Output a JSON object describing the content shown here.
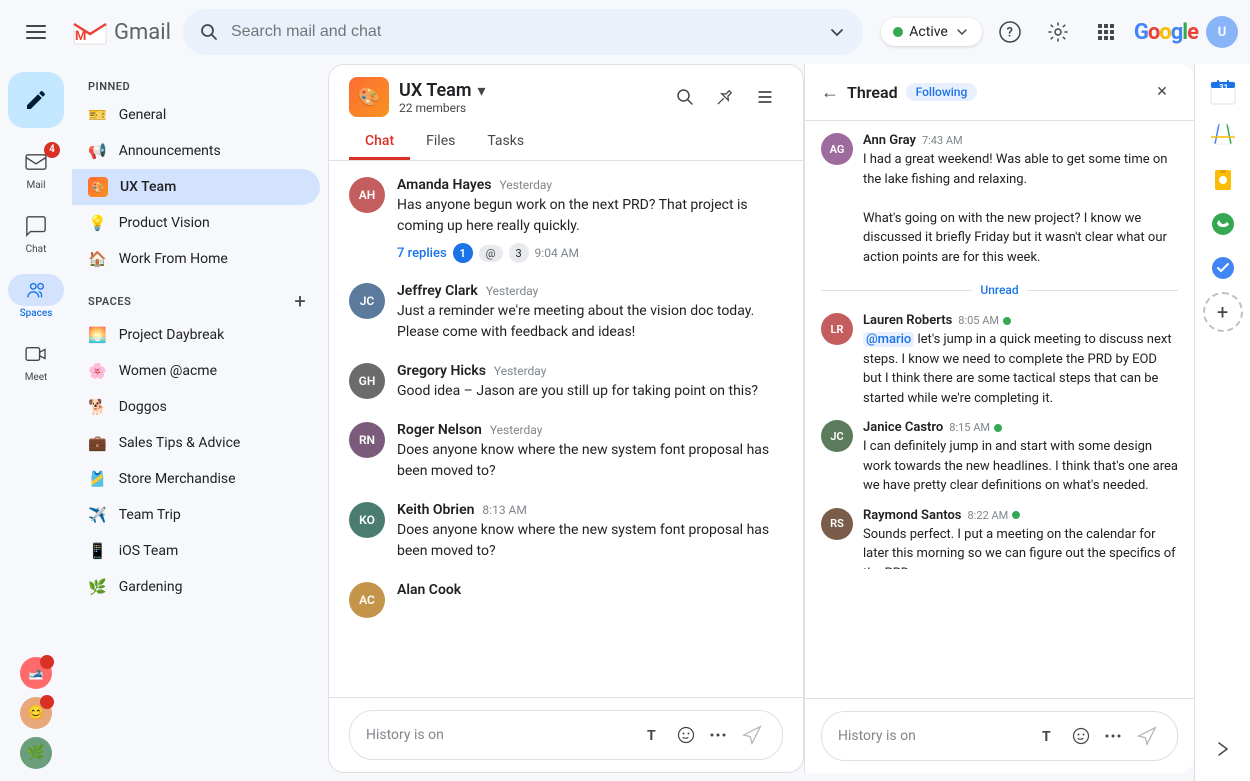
{
  "topbar": {
    "search_placeholder": "Search mail and chat",
    "active_label": "Active",
    "active_dropdown": "▾"
  },
  "left_nav": {
    "compose_icon": "✏",
    "nav_items": [
      {
        "id": "mail",
        "label": "Mail",
        "icon": "✉",
        "badge": "4"
      },
      {
        "id": "chat",
        "label": "Chat",
        "icon": "💬",
        "badge": null
      },
      {
        "id": "spaces",
        "label": "Spaces",
        "icon": "👥",
        "active": true
      },
      {
        "id": "meet",
        "label": "Meet",
        "icon": "📹",
        "badge": null
      }
    ]
  },
  "sidebar": {
    "pinned_label": "PINNED",
    "spaces_label": "SPACES",
    "pinned_items": [
      {
        "id": "general",
        "label": "General",
        "icon": "🎫"
      },
      {
        "id": "announcements",
        "label": "Announcements",
        "icon": "📢"
      },
      {
        "id": "ux-team",
        "label": "UX Team",
        "icon": "🎨",
        "active": true
      },
      {
        "id": "product-vision",
        "label": "Product Vision",
        "icon": "💡"
      },
      {
        "id": "work-from-home",
        "label": "Work From Home",
        "icon": "🏠"
      }
    ],
    "spaces_items": [
      {
        "id": "project-daybreak",
        "label": "Project Daybreak",
        "icon": "🌅"
      },
      {
        "id": "women-acme",
        "label": "Women @acme",
        "icon": "🌸"
      },
      {
        "id": "doggos",
        "label": "Doggos",
        "icon": "🐕"
      },
      {
        "id": "sales-tips",
        "label": "Sales Tips & Advice",
        "icon": "💼"
      },
      {
        "id": "store-merchandise",
        "label": "Store Merchandise",
        "icon": "🎽"
      },
      {
        "id": "team-trip",
        "label": "Team Trip",
        "icon": "✈"
      },
      {
        "id": "ios-team",
        "label": "iOS Team",
        "icon": "📱"
      },
      {
        "id": "gardening",
        "label": "Gardening",
        "icon": "🌿"
      }
    ]
  },
  "chat": {
    "team_name": "UX Team",
    "members_count": "22 members",
    "tabs": [
      {
        "id": "chat",
        "label": "Chat",
        "active": true
      },
      {
        "id": "files",
        "label": "Files",
        "active": false
      },
      {
        "id": "tasks",
        "label": "Tasks",
        "active": false
      }
    ],
    "messages": [
      {
        "id": "msg1",
        "name": "Amanda Hayes",
        "time": "Yesterday",
        "text": "Has anyone begun work on the next PRD? That project is coming up here really quickly.",
        "avatar_bg": "#c45e5e",
        "avatar_text": "AH",
        "replies_label": "7 replies",
        "reply_badges": [
          "1",
          "3"
        ],
        "reply_time": "9:04 AM"
      },
      {
        "id": "msg2",
        "name": "Jeffrey Clark",
        "time": "Yesterday",
        "text": "Just a reminder we're meeting about the vision doc today. Please come with feedback and ideas!",
        "avatar_bg": "#5c7a9c",
        "avatar_text": "JC"
      },
      {
        "id": "msg3",
        "name": "Gregory Hicks",
        "time": "Yesterday",
        "text": "Good idea – Jason are you still up for taking point on this?",
        "avatar_bg": "#6b6b6b",
        "avatar_text": "GH"
      },
      {
        "id": "msg4",
        "name": "Roger Nelson",
        "time": "Yesterday",
        "text": "Does anyone know where the new system font proposal has been moved to?",
        "avatar_bg": "#7a5c7a",
        "avatar_text": "RN"
      },
      {
        "id": "msg5",
        "name": "Keith Obrien",
        "time": "8:13 AM",
        "text": "Does anyone know where the new system font proposal has been moved to?",
        "avatar_bg": "#4a7c6f",
        "avatar_text": "KO"
      },
      {
        "id": "msg6",
        "name": "Alan Cook",
        "time": "",
        "text": "",
        "avatar_bg": "#c4944a",
        "avatar_text": "AC"
      }
    ],
    "input_placeholder": "History is on"
  },
  "thread": {
    "title": "Thread",
    "following_label": "Following",
    "back_icon": "←",
    "close_icon": "✕",
    "messages": [
      {
        "id": "t1",
        "name": "Ann Gray",
        "time": "7:43 AM",
        "online": false,
        "avatar_bg": "#9e6b9e",
        "avatar_text": "AG",
        "text": "I had a great weekend! Was able to get some time on the lake fishing and relaxing.\n\nWhat's going on with the new project? I know we discussed it briefly Friday but it wasn't clear what our action points are for this week."
      },
      {
        "id": "t2",
        "name": "Lauren Roberts",
        "time": "8:05 AM",
        "online": true,
        "avatar_bg": "#c45e5e",
        "avatar_text": "LR",
        "mention": "@mario",
        "text": "let's jump in a quick meeting to discuss next steps. I know we need to complete the PRD by EOD but I think there are some tactical steps that can be started while we're completing it."
      },
      {
        "id": "t3",
        "name": "Janice Castro",
        "time": "8:15 AM",
        "online": true,
        "avatar_bg": "#5c7a5c",
        "avatar_text": "JC",
        "text": "I can definitely jump in and start with some design work towards the new headlines. I think that's one area we have pretty clear definitions on what's needed."
      },
      {
        "id": "t4",
        "name": "Raymond Santos",
        "time": "8:22 AM",
        "online": true,
        "avatar_bg": "#7a5c4a",
        "avatar_text": "RS",
        "text": "Sounds perfect. I put a meeting on the calendar for later this morning so we can figure out the specifics of the PRD."
      }
    ],
    "unread_label": "Unread",
    "input_placeholder": "History is on"
  }
}
